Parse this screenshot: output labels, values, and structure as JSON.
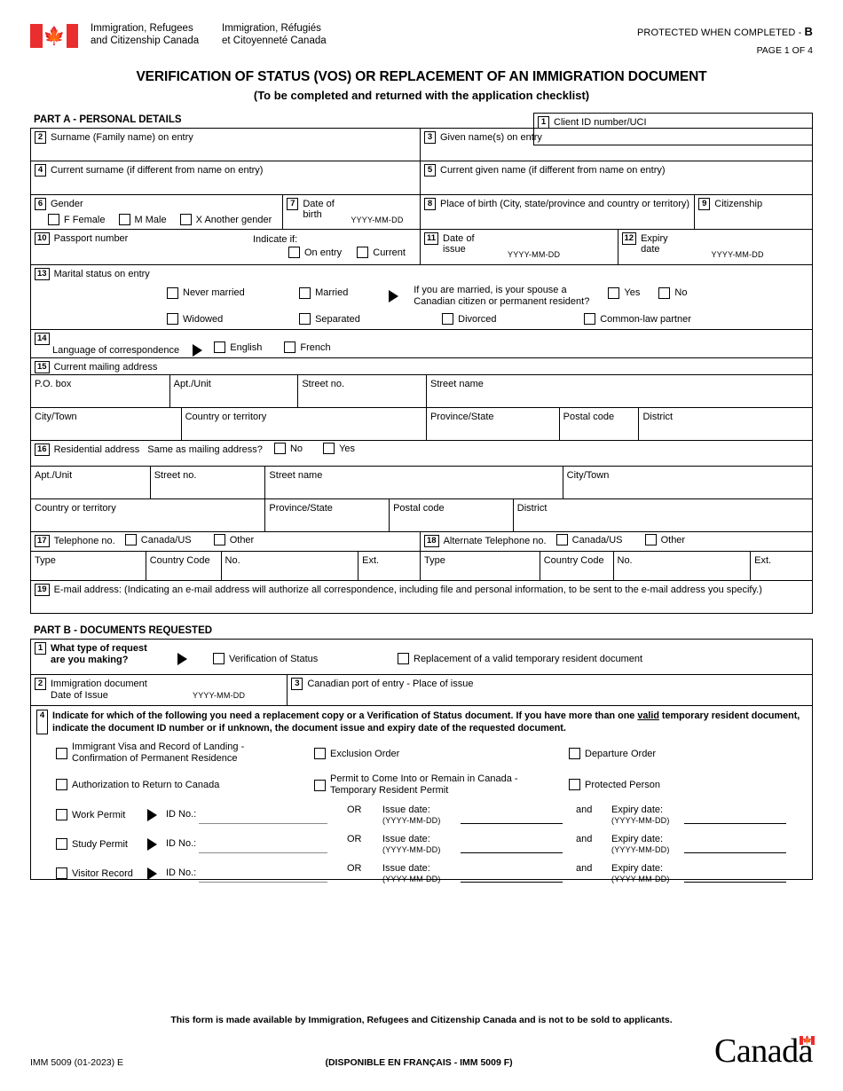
{
  "header": {
    "dept_en_line1": "Immigration, Refugees",
    "dept_en_line2": "and Citizenship Canada",
    "dept_fr_line1": "Immigration, Réfugiés",
    "dept_fr_line2": "et Citoyenneté Canada",
    "protected_text": "PROTECTED WHEN COMPLETED - ",
    "protected_level": "B",
    "page_of": "PAGE 1 OF 4",
    "flag_icon": "canada-flag-icon"
  },
  "title": {
    "line1": "VERIFICATION OF STATUS (VOS) OR REPLACEMENT OF AN IMMIGRATION DOCUMENT",
    "line2": "(To be completed and returned with the application checklist)"
  },
  "part_a": {
    "heading": "PART A - PERSONAL DETAILS",
    "f1": {
      "num": "1",
      "label": "Client ID number/UCI"
    },
    "f2": {
      "num": "2",
      "label": "Surname (Family name) on entry"
    },
    "f3": {
      "num": "3",
      "label": "Given name(s) on entry"
    },
    "f4": {
      "num": "4",
      "label": "Current surname (if different from name on entry)"
    },
    "f5": {
      "num": "5",
      "label": "Current given name (if different from name on entry)"
    },
    "f6": {
      "num": "6",
      "label": "Gender",
      "options": [
        "F Female",
        "M Male",
        "X Another gender"
      ]
    },
    "f7": {
      "num": "7",
      "label_l1": "Date of",
      "label_l2": "birth",
      "format": "YYYY-MM-DD"
    },
    "f8": {
      "num": "8",
      "label": "Place of birth (City, state/province and country or territory)"
    },
    "f9": {
      "num": "9",
      "label": "Citizenship"
    },
    "f10": {
      "num": "10",
      "label": "Passport number",
      "indicate": "Indicate if:",
      "options": [
        "On entry",
        "Current"
      ]
    },
    "f11": {
      "num": "11",
      "label_l1": "Date of",
      "label_l2": "issue",
      "format": "YYYY-MM-DD"
    },
    "f12": {
      "num": "12",
      "label_l1": "Expiry",
      "label_l2": "date",
      "format": "YYYY-MM-DD"
    },
    "f13": {
      "num": "13",
      "label": "Marital status on entry",
      "row1": [
        "Never married",
        "Married"
      ],
      "spouse_q_l1": "If you are married, is your spouse a",
      "spouse_q_l2": "Canadian citizen or permanent resident?",
      "spouse_opts": [
        "Yes",
        "No"
      ],
      "row2": [
        "Widowed",
        "Separated",
        "Divorced",
        "Common-law partner"
      ]
    },
    "f14": {
      "num": "14",
      "label": "Language of correspondence",
      "options": [
        "English",
        "French"
      ]
    },
    "f15": {
      "num": "15",
      "label": "Current mailing address",
      "row1": [
        "P.O. box",
        "Apt./Unit",
        "Street no.",
        "Street name"
      ],
      "row2": [
        "City/Town",
        "Country or territory",
        "Province/State",
        "Postal code",
        "District"
      ]
    },
    "f16": {
      "num": "16",
      "label": "Residential address",
      "question": "Same as mailing address?",
      "options": [
        "No",
        "Yes"
      ],
      "row1": [
        "Apt./Unit",
        "Street no.",
        "Street name",
        "City/Town"
      ],
      "row2": [
        "Country or territory",
        "Province/State",
        "Postal code",
        "District"
      ]
    },
    "f17": {
      "num": "17",
      "label": "Telephone no.",
      "options": [
        "Canada/US",
        "Other"
      ],
      "cols": [
        "Type",
        "Country Code",
        "No.",
        "Ext."
      ]
    },
    "f18": {
      "num": "18",
      "label": "Alternate Telephone no.",
      "options": [
        "Canada/US",
        "Other"
      ],
      "cols": [
        "Type",
        "Country Code",
        "No.",
        "Ext."
      ]
    },
    "f19": {
      "num": "19",
      "label": "E-mail address: (Indicating an e-mail address will authorize all correspondence, including file and personal information, to be sent to the e-mail address you specify.)"
    }
  },
  "part_b": {
    "heading": "PART B - DOCUMENTS REQUESTED",
    "b1": {
      "num": "1",
      "label_l1": "What type of request",
      "label_l2": "are you making?",
      "options": [
        "Verification of Status",
        "Replacement of a valid temporary resident document"
      ]
    },
    "b2": {
      "num": "2",
      "label_l1": "Immigration document",
      "label_l2": "Date of Issue",
      "format": "YYYY-MM-DD"
    },
    "b3": {
      "num": "3",
      "label": "Canadian port of entry - Place of issue"
    },
    "b4": {
      "num": "4",
      "text_l1": "Indicate for which of the following you need a replacement copy or a Verification of Status document. If you have more than one ",
      "text_underline": "valid",
      "text_l1b": " temporary resident document,",
      "text_l2": "indicate the document ID number or if unknown, the document issue and expiry date of the requested document.",
      "checkboxes": [
        {
          "label_l1": "Immigrant Visa and Record of Landing -",
          "label_l2": "Confirmation of Permanent Residence"
        },
        {
          "label_l1": "Exclusion Order",
          "label_l2": ""
        },
        {
          "label_l1": "Departure Order",
          "label_l2": ""
        },
        {
          "label_l1": "Authorization to Return to Canada",
          "label_l2": ""
        },
        {
          "label_l1": "Permit to Come Into or Remain in Canada -",
          "label_l2": "Temporary Resident Permit"
        },
        {
          "label_l1": "Protected Person",
          "label_l2": ""
        }
      ],
      "permits": [
        {
          "label": "Work Permit"
        },
        {
          "label": "Study Permit"
        },
        {
          "label": "Visitor Record"
        }
      ],
      "id_label": "ID No.:",
      "or_label": "OR",
      "issue_label": "Issue date:",
      "and_label": "and",
      "expiry_label": "Expiry date:",
      "date_format": "(YYYY-MM-DD)"
    }
  },
  "footer": {
    "notice": "This form is made available by Immigration, Refugees and Citizenship Canada and is not to be sold to applicants.",
    "form_id": "IMM 5009 (01-2023) E",
    "french_note": "(DISPONIBLE EN FRANÇAIS - IMM 5009 F)",
    "wordmark": "Canada",
    "wordmark_flag_icon": "canada-flag-icon"
  }
}
